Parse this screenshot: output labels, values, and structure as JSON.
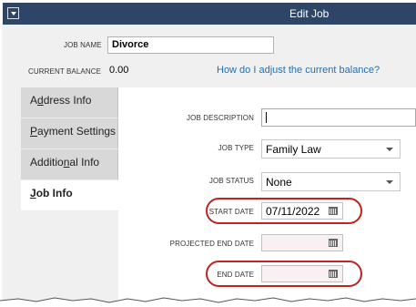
{
  "window": {
    "title": "Edit Job"
  },
  "header": {
    "job_name_label": "JOB NAME",
    "job_name_value": "Divorce",
    "current_balance_label": "CURRENT BALANCE",
    "current_balance_value": "0.00",
    "adjust_link": "How do I adjust the current balance?"
  },
  "tabs": [
    {
      "pre": "A",
      "u": "d",
      "post": "dress Info",
      "active": false
    },
    {
      "pre": "",
      "u": "P",
      "post": "ayment Settings",
      "active": false
    },
    {
      "pre": "Additio",
      "u": "n",
      "post": "al Info",
      "active": false
    },
    {
      "pre": "",
      "u": "J",
      "post": "ob Info",
      "active": true
    }
  ],
  "form": {
    "job_description": {
      "label": "JOB DESCRIPTION",
      "value": ""
    },
    "job_type": {
      "label": "JOB TYPE",
      "value": "Family Law"
    },
    "job_status": {
      "label": "JOB STATUS",
      "value": "None"
    },
    "start_date": {
      "label": "START DATE",
      "value": "07/11/2022"
    },
    "projected_end_date": {
      "label": "PROJECTED END DATE",
      "value": ""
    },
    "end_date": {
      "label": "END DATE",
      "value": ""
    }
  },
  "colors": {
    "titlebar": "#2d4566",
    "link": "#1f6fb5",
    "highlight": "#c0231f"
  },
  "icons": [
    "dropdown-menu-icon",
    "calendar-icon",
    "chevron-down-icon"
  ]
}
